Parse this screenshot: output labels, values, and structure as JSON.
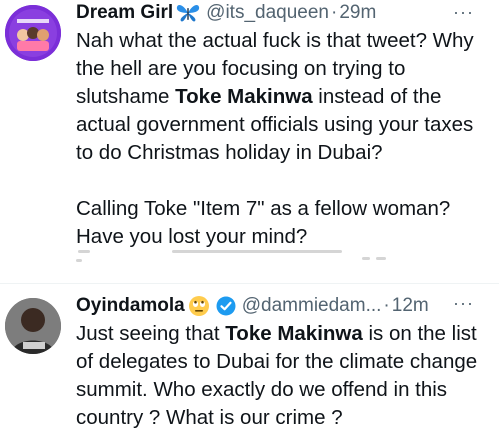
{
  "tweet1": {
    "name": "Dream Girl",
    "emoji": "butterfly-emoji",
    "handle": "@its_daqueen",
    "separator": "·",
    "time": "29m",
    "more": "···",
    "line1_a": "Nah what the actual fuck is that tweet? Why the hell are you focusing on trying to slutshame ",
    "line1_bold": "Toke Makinwa",
    "line1_b": " instead of the actual government officials using your taxes to do Christmas holiday in Dubai?",
    "line2": "Calling Toke \"Item  7\" as a fellow woman? Have you lost your mind?"
  },
  "tweet2": {
    "name": "Oyindamola",
    "emoji": "rolling-eyes-emoji",
    "verified": "verified-badge",
    "handle": "@dammiedam...",
    "separator": "·",
    "time": "12m",
    "more": "···",
    "text_a": "Just seeing that ",
    "text_bold": "Toke Makinwa",
    "text_b": " is on the list of delegates to Dubai for the climate change summit. Who exactly do we offend in this country ? What is our crime ?"
  },
  "colors": {
    "text": "#0f1419",
    "muted": "#536471",
    "verified": "#1d9bf0",
    "divider": "#eff3f4"
  }
}
